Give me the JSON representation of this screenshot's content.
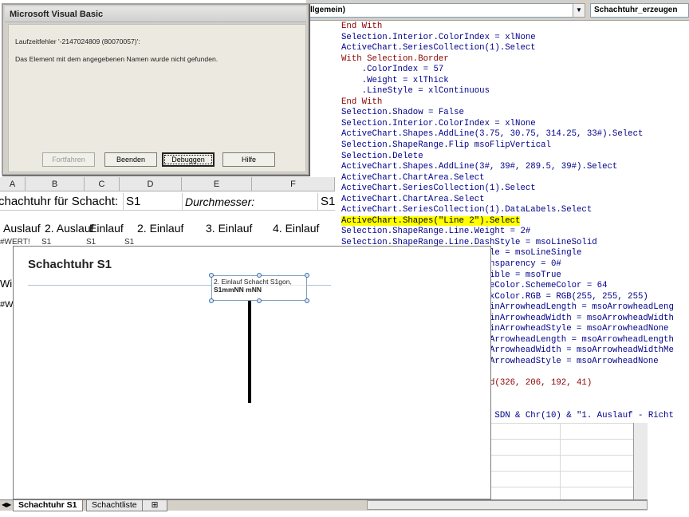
{
  "vba": {
    "object_combo": "(Allgemein)",
    "object_combo_visible": "llgemein)",
    "proc_combo": "Schachtuhr_erzeugen",
    "code_lines": [
      {
        "text": "End With",
        "kind": "kw"
      },
      {
        "text": "Selection.Interior.ColorIndex = xlNone",
        "kind": "code"
      },
      {
        "text": "ActiveChart.SeriesCollection(1).Select",
        "kind": "code"
      },
      {
        "text": "With Selection.Border",
        "kind": "kw"
      },
      {
        "text": "    .ColorIndex = 57",
        "kind": "code"
      },
      {
        "text": "    .Weight = xlThick",
        "kind": "code"
      },
      {
        "text": "    .LineStyle = xlContinuous",
        "kind": "code"
      },
      {
        "text": "End With",
        "kind": "kw"
      },
      {
        "text": "Selection.Shadow = False",
        "kind": "code"
      },
      {
        "text": "Selection.Interior.ColorIndex = xlNone",
        "kind": "code"
      },
      {
        "text": "ActiveChart.Shapes.AddLine(3.75, 30.75, 314.25, 33#).Select",
        "kind": "code"
      },
      {
        "text": "Selection.ShapeRange.Flip msoFlipVertical",
        "kind": "code"
      },
      {
        "text": "Selection.Delete",
        "kind": "code"
      },
      {
        "text": "ActiveChart.Shapes.AddLine(3#, 39#, 289.5, 39#).Select",
        "kind": "code"
      },
      {
        "text": "ActiveChart.ChartArea.Select",
        "kind": "code"
      },
      {
        "text": "ActiveChart.SeriesCollection(1).Select",
        "kind": "code"
      },
      {
        "text": "ActiveChart.ChartArea.Select",
        "kind": "code"
      },
      {
        "text": "ActiveChart.SeriesCollection(1).DataLabels.Select",
        "kind": "code"
      },
      {
        "text": "ActiveChart.Shapes(\"Line 2\").Select",
        "kind": "hl"
      },
      {
        "text": "Selection.ShapeRange.Line.Weight = 2#",
        "kind": "code"
      },
      {
        "text": "Selection.ShapeRange.Line.DashStyle = msoLineSolid",
        "kind": "code"
      },
      {
        "text": "Selection.ShapeRange.Line.Style = msoLineSingle",
        "kind": "code"
      },
      {
        "text": "Selection.ShapeRange.Line.Transparency = 0#",
        "kind": "code"
      },
      {
        "text": "Selection.ShapeRange.Line.Visible = msoTrue",
        "kind": "code"
      },
      {
        "text": "Selection.ShapeRange.Line.ForeColor.SchemeColor = 64",
        "kind": "code"
      },
      {
        "text": "Selection.ShapeRange.Line.BackColor.RGB = RGB(255, 255, 255)",
        "kind": "code"
      },
      {
        "text": "Selection.ShapeRange.Line.BeginArrowheadLength = msoArrowheadLeng",
        "kind": "code"
      },
      {
        "text": "Selection.ShapeRange.Line.BeginArrowheadWidth = msoArrowheadWidth",
        "kind": "code"
      },
      {
        "text": "Selection.ShapeRange.Line.BeginArrowheadStyle = msoArrowheadNone",
        "kind": "code"
      },
      {
        "text": "Selection.ShapeRange.Line.EndArrowheadLength = msoArrowheadLength",
        "kind": "code"
      },
      {
        "text": "Selection.ShapeRange.Line.EndArrowheadWidth = msoArrowheadWidthMe",
        "kind": "code"
      },
      {
        "text": "Selection.ShapeRange.Line.EndArrowheadStyle = msoArrowheadNone",
        "kind": "code"
      },
      {
        "text": "ActiveChart.ChartArea.Select",
        "kind": "code"
      },
      {
        "text": "With ActiveChart.TextBoxes.Add(326, 206, 192, 41)",
        "kind": "kw"
      },
      {
        "text": "    .Select",
        "kind": "code"
      },
      {
        "text": "    .AutoSize = True",
        "kind": "code"
      },
      {
        "text": "    .Text = \"Durchmesser: \" & SDN & Chr(10) & \"1. Auslauf - Richt",
        "kind": "code"
      }
    ]
  },
  "excel": {
    "columns": [
      "A",
      "B",
      "C",
      "D",
      "E",
      "F"
    ],
    "title_text": "chachtuhr für Schacht:",
    "title_value": "S1",
    "diameter_label": "Durchmesser:",
    "s1_right": "S1",
    "labels": [
      "Auslauf",
      "2. Auslauf",
      "Einlauf",
      "2. Einlauf",
      "3. Einlauf",
      "4. Einlauf"
    ],
    "err_row": "#WERT!",
    "err_cells": [
      "S1",
      "S1",
      "S1"
    ],
    "side_fragments": [
      "Wi",
      "#W"
    ]
  },
  "chart": {
    "title": "Schachtuhr S1",
    "textbox_line1": "2. Einlauf Schacht S1gon,",
    "textbox_line2": "S1mmNN mNN"
  },
  "sheets": {
    "active": "Schachtuhr S1",
    "other": "Schachtliste",
    "new_tab_icon": "new-sheet-icon"
  },
  "dialog": {
    "title": "Microsoft Visual Basic",
    "error_line": "Laufzeitfehler '-2147024809 (80070057)':",
    "message": "Das Element mit dem angegebenen Namen wurde nicht gefunden.",
    "buttons": {
      "continue": "Fortfahren",
      "end": "Beenden",
      "debug": "Debuggen",
      "help": "Hilfe"
    }
  },
  "colors": {
    "code_blue": "#00008b",
    "keyword_red": "#8b0000",
    "highlight": "#ffff00"
  }
}
